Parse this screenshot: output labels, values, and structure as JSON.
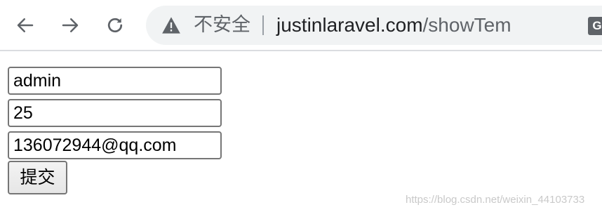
{
  "browser": {
    "security_label": "不安全",
    "url_host": "justinlaravel.com",
    "url_path": "/showTem",
    "icons": {
      "back": "back-arrow-icon",
      "forward": "forward-arrow-icon",
      "reload": "reload-icon",
      "warning": "warning-triangle-icon",
      "translate": "translate-icon"
    },
    "translate_glyph": "G"
  },
  "form": {
    "name_value": "admin",
    "age_value": "25",
    "email_value": "136072944@qq.com",
    "submit_label": "提交"
  },
  "watermark": "https://blog.csdn.net/weixin_44103733"
}
